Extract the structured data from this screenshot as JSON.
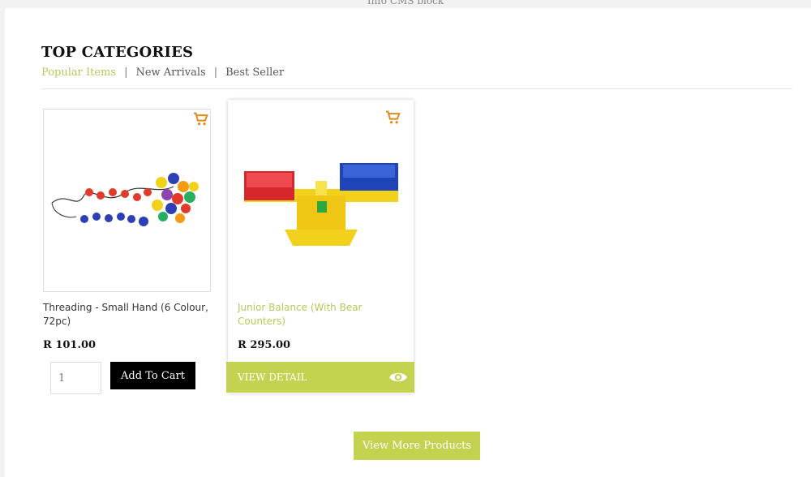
{
  "top_note": "Info CMS block",
  "section": {
    "heading": "TOP CATEGORIES",
    "tabs": [
      {
        "label": "Popular Items",
        "active": true
      },
      {
        "label": "New Arrivals",
        "active": false
      },
      {
        "label": "Best Seller",
        "active": false
      }
    ],
    "separator": "|"
  },
  "products": [
    {
      "title": "Threading - Small Hand (6 Colour, 72pc)",
      "price": "R 101.00",
      "qty": "1",
      "add_to_cart": "Add To Cart",
      "icon": "cart-icon"
    },
    {
      "title": "Junior Balance (With Bear Counters)",
      "price": "R 295.00",
      "view_detail": "VIEW DETAIL",
      "icon": "cart-icon",
      "detail_icon": "eye-icon"
    }
  ],
  "view_more": "View More Products",
  "colors": {
    "accent": "#c3d24f",
    "accent_text": "#b7c957",
    "black": "#000000"
  }
}
